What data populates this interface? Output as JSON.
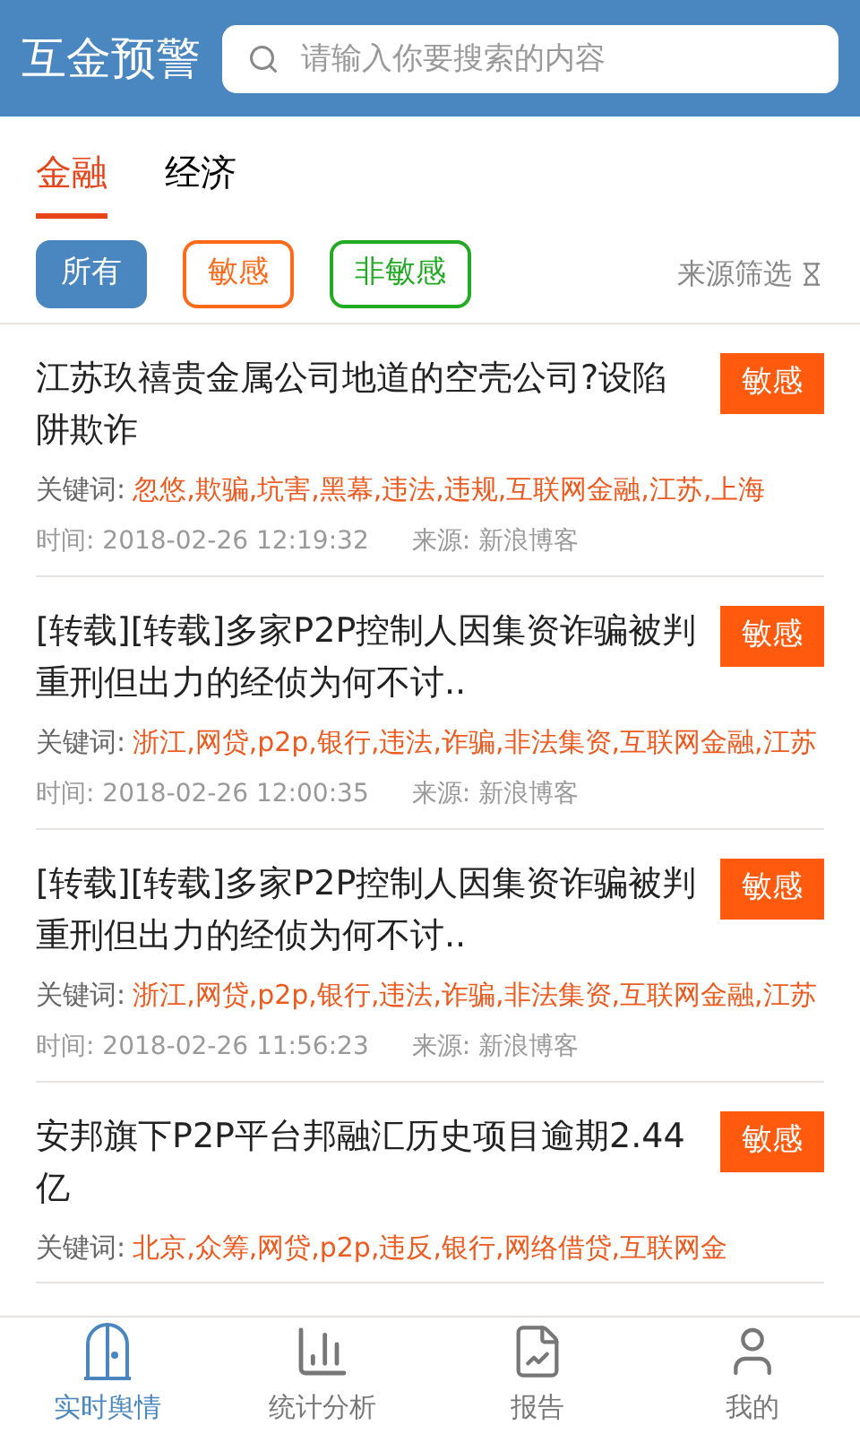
{
  "header": {
    "title": "互金预警",
    "search": {
      "placeholder": "请输入你要搜索的内容"
    }
  },
  "tabs": [
    {
      "label": "金融",
      "selected": true
    },
    {
      "label": "经济",
      "selected": false
    }
  ],
  "filters": [
    {
      "label": "所有",
      "selected": true,
      "color": "#4a86c0"
    },
    {
      "label": "敏感",
      "selected": false,
      "color": "#ff6a1a"
    },
    {
      "label": "非敏感",
      "selected": false,
      "color": "#22aa22"
    }
  ],
  "source_filter": "来源筛选",
  "articles": [
    {
      "title": "江苏玖禧贵金属公司地道的空壳公司?设陷阱欺诈",
      "badge": "敏感",
      "keywords_label": "关键词:",
      "keywords": "忽悠,欺骗,坑害,黑幕,违法,违规,互联网金融,江苏,上海",
      "time": "时间: 2018-02-26 12:19:32",
      "source": "来源: 新浪博客"
    },
    {
      "title": "[转载][转载]多家P2P控制人因集资诈骗被判重刑但出力的经侦为何不讨..",
      "badge": "敏感",
      "keywords_label": "关键词:",
      "keywords": "浙江,网贷,p2p,银行,违法,诈骗,非法集资,互联网金融,江苏",
      "time": "时间: 2018-02-26 12:00:35",
      "source": "来源: 新浪博客"
    },
    {
      "title": "[转载][转载]多家P2P控制人因集资诈骗被判重刑但出力的经侦为何不讨..",
      "badge": "敏感",
      "keywords_label": "关键词:",
      "keywords": "浙江,网贷,p2p,银行,违法,诈骗,非法集资,互联网金融,江苏",
      "time": "时间: 2018-02-26 11:56:23",
      "source": "来源: 新浪博客"
    },
    {
      "title": "安邦旗下P2P平台邦融汇历史项目逾期2.44亿",
      "badge": "敏感",
      "keywords_label": "关键词:",
      "keywords": "北京,众筹,网贷,p2p,违反,银行,网络借贷,互联网金"
    }
  ],
  "nav": [
    {
      "label": "实时舆情",
      "kind": "door",
      "selected": true
    },
    {
      "label": "统计分析",
      "kind": "chart",
      "selected": false
    },
    {
      "label": "报告",
      "kind": "report",
      "selected": false
    },
    {
      "label": "我的",
      "kind": "user",
      "selected": false
    }
  ]
}
